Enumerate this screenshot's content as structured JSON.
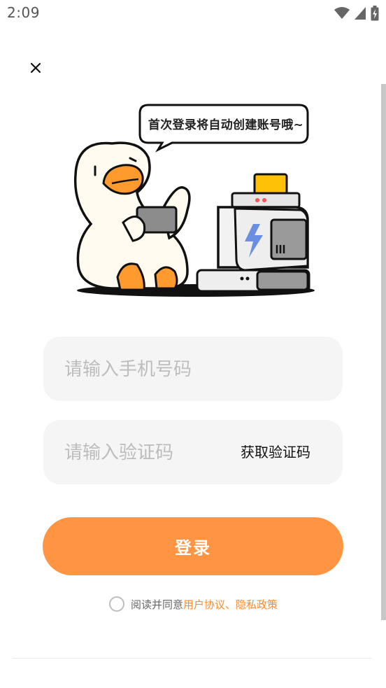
{
  "status_bar": {
    "time": "2:09"
  },
  "speech_bubble": {
    "text": "首次登录将自动创建账号哦~"
  },
  "phone_input": {
    "placeholder": "请输入手机号码"
  },
  "code_input": {
    "placeholder": "请输入验证码",
    "get_code_label": "获取验证码"
  },
  "login_button": {
    "label": "登录"
  },
  "agreement": {
    "prefix": "阅读并同意 ",
    "user_agreement": "用户协议",
    "separator": "、",
    "privacy_policy": "隐私政策"
  },
  "colors": {
    "accent": "#ff9543",
    "link": "#ff8a2b",
    "input_bg": "#f5f5f5",
    "duck_bill": "#ff9a2e",
    "lightning": "#6b8fe0"
  }
}
